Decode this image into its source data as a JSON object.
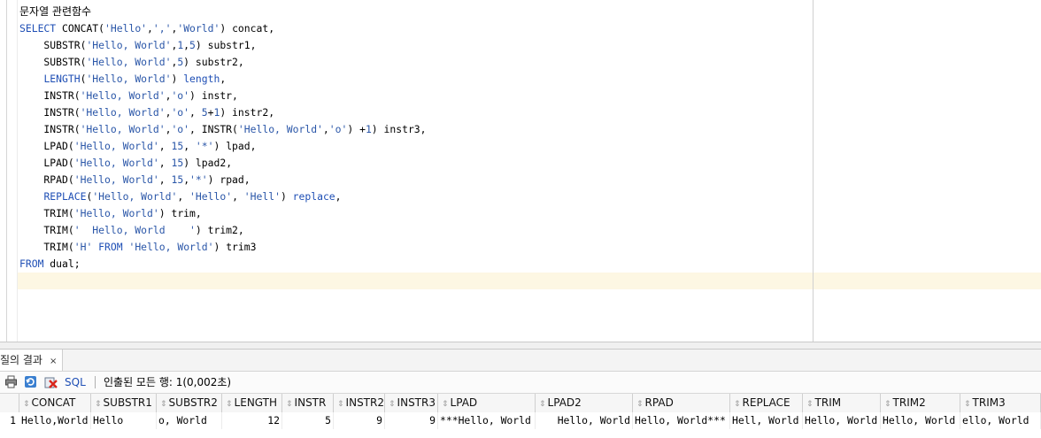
{
  "editor": {
    "lines": [
      {
        "parts": [
          {
            "t": "문자열 관련함수",
            "c": ""
          }
        ],
        "kor": true
      },
      {
        "parts": [
          {
            "t": "SELECT",
            "c": "kw"
          },
          {
            "t": " CONCAT(",
            "c": ""
          },
          {
            "t": "'Hello'",
            "c": "str"
          },
          {
            "t": ",",
            "c": ""
          },
          {
            "t": "','",
            "c": "str"
          },
          {
            "t": ",",
            "c": ""
          },
          {
            "t": "'World'",
            "c": "str"
          },
          {
            "t": ") concat,",
            "c": ""
          }
        ]
      },
      {
        "parts": [
          {
            "t": "    SUBSTR(",
            "c": ""
          },
          {
            "t": "'Hello, World'",
            "c": "str"
          },
          {
            "t": ",",
            "c": ""
          },
          {
            "t": "1",
            "c": "num"
          },
          {
            "t": ",",
            "c": ""
          },
          {
            "t": "5",
            "c": "num"
          },
          {
            "t": ") substr1,",
            "c": ""
          }
        ]
      },
      {
        "parts": [
          {
            "t": "    SUBSTR(",
            "c": ""
          },
          {
            "t": "'Hello, World'",
            "c": "str"
          },
          {
            "t": ",",
            "c": ""
          },
          {
            "t": "5",
            "c": "num"
          },
          {
            "t": ") substr2,",
            "c": ""
          }
        ]
      },
      {
        "parts": [
          {
            "t": "    ",
            "c": ""
          },
          {
            "t": "LENGTH",
            "c": "fn-blue"
          },
          {
            "t": "(",
            "c": ""
          },
          {
            "t": "'Hello, World'",
            "c": "str"
          },
          {
            "t": ") ",
            "c": ""
          },
          {
            "t": "length",
            "c": "kw"
          },
          {
            "t": ",",
            "c": ""
          }
        ]
      },
      {
        "parts": [
          {
            "t": "    INSTR(",
            "c": ""
          },
          {
            "t": "'Hello, World'",
            "c": "str"
          },
          {
            "t": ",",
            "c": ""
          },
          {
            "t": "'o'",
            "c": "str"
          },
          {
            "t": ") instr,",
            "c": ""
          }
        ]
      },
      {
        "parts": [
          {
            "t": "    INSTR(",
            "c": ""
          },
          {
            "t": "'Hello, World'",
            "c": "str"
          },
          {
            "t": ",",
            "c": ""
          },
          {
            "t": "'o'",
            "c": "str"
          },
          {
            "t": ", ",
            "c": ""
          },
          {
            "t": "5",
            "c": "num"
          },
          {
            "t": "+",
            "c": ""
          },
          {
            "t": "1",
            "c": "num"
          },
          {
            "t": ") instr2,",
            "c": ""
          }
        ]
      },
      {
        "parts": [
          {
            "t": "    INSTR(",
            "c": ""
          },
          {
            "t": "'Hello, World'",
            "c": "str"
          },
          {
            "t": ",",
            "c": ""
          },
          {
            "t": "'o'",
            "c": "str"
          },
          {
            "t": ", INSTR(",
            "c": ""
          },
          {
            "t": "'Hello, World'",
            "c": "str"
          },
          {
            "t": ",",
            "c": ""
          },
          {
            "t": "'o'",
            "c": "str"
          },
          {
            "t": ") +",
            "c": ""
          },
          {
            "t": "1",
            "c": "num"
          },
          {
            "t": ") instr3,",
            "c": ""
          }
        ]
      },
      {
        "parts": [
          {
            "t": "    LPAD(",
            "c": ""
          },
          {
            "t": "'Hello, World'",
            "c": "str"
          },
          {
            "t": ", ",
            "c": ""
          },
          {
            "t": "15",
            "c": "num"
          },
          {
            "t": ", ",
            "c": ""
          },
          {
            "t": "'*'",
            "c": "str"
          },
          {
            "t": ") lpad,",
            "c": ""
          }
        ]
      },
      {
        "parts": [
          {
            "t": "    LPAD(",
            "c": ""
          },
          {
            "t": "'Hello, World'",
            "c": "str"
          },
          {
            "t": ", ",
            "c": ""
          },
          {
            "t": "15",
            "c": "num"
          },
          {
            "t": ") lpad2,",
            "c": ""
          }
        ]
      },
      {
        "parts": [
          {
            "t": "    RPAD(",
            "c": ""
          },
          {
            "t": "'Hello, World'",
            "c": "str"
          },
          {
            "t": ", ",
            "c": ""
          },
          {
            "t": "15",
            "c": "num"
          },
          {
            "t": ",",
            "c": ""
          },
          {
            "t": "'*'",
            "c": "str"
          },
          {
            "t": ") rpad,",
            "c": ""
          }
        ]
      },
      {
        "parts": [
          {
            "t": "    ",
            "c": ""
          },
          {
            "t": "REPLACE",
            "c": "fn-blue"
          },
          {
            "t": "(",
            "c": ""
          },
          {
            "t": "'Hello, World'",
            "c": "str"
          },
          {
            "t": ", ",
            "c": ""
          },
          {
            "t": "'Hello'",
            "c": "str"
          },
          {
            "t": ", ",
            "c": ""
          },
          {
            "t": "'Hell'",
            "c": "str"
          },
          {
            "t": ") ",
            "c": ""
          },
          {
            "t": "replace",
            "c": "kw"
          },
          {
            "t": ",",
            "c": ""
          }
        ]
      },
      {
        "parts": [
          {
            "t": "    TRIM(",
            "c": ""
          },
          {
            "t": "'Hello, World'",
            "c": "str"
          },
          {
            "t": ") trim,",
            "c": ""
          }
        ]
      },
      {
        "parts": [
          {
            "t": "    TRIM(",
            "c": ""
          },
          {
            "t": "'  Hello, World    '",
            "c": "str"
          },
          {
            "t": ") trim2,",
            "c": ""
          }
        ]
      },
      {
        "parts": [
          {
            "t": "    TRIM(",
            "c": ""
          },
          {
            "t": "'H'",
            "c": "str"
          },
          {
            "t": " ",
            "c": ""
          },
          {
            "t": "FROM",
            "c": "kw"
          },
          {
            "t": " ",
            "c": ""
          },
          {
            "t": "'Hello, World'",
            "c": "str"
          },
          {
            "t": ") trim3",
            "c": ""
          }
        ]
      },
      {
        "parts": [
          {
            "t": "FROM",
            "c": "kw"
          },
          {
            "t": " dual;",
            "c": ""
          }
        ]
      }
    ]
  },
  "results": {
    "tab_label": "질의 결과",
    "tab_close": "×",
    "toolbar": {
      "sql_label": "SQL",
      "status": "인출된 모든 행: 1(0,002초)"
    },
    "columns": [
      "CONCAT",
      "SUBSTR1",
      "SUBSTR2",
      "LENGTH",
      "INSTR",
      "INSTR2",
      "INSTR3",
      "LPAD",
      "LPAD2",
      "RPAD",
      "REPLACE",
      "TRIM",
      "TRIM2",
      "TRIM3"
    ],
    "rows": [
      {
        "num": "1",
        "cells": [
          "Hello,World",
          "Hello",
          "o, World",
          "12",
          "5",
          "9",
          "9",
          "***Hello, World",
          "   Hello, World",
          "Hello, World***",
          "Hell, World",
          "Hello, World",
          "Hello, World",
          "ello, World"
        ]
      }
    ],
    "sort_glyph": "⇕"
  }
}
